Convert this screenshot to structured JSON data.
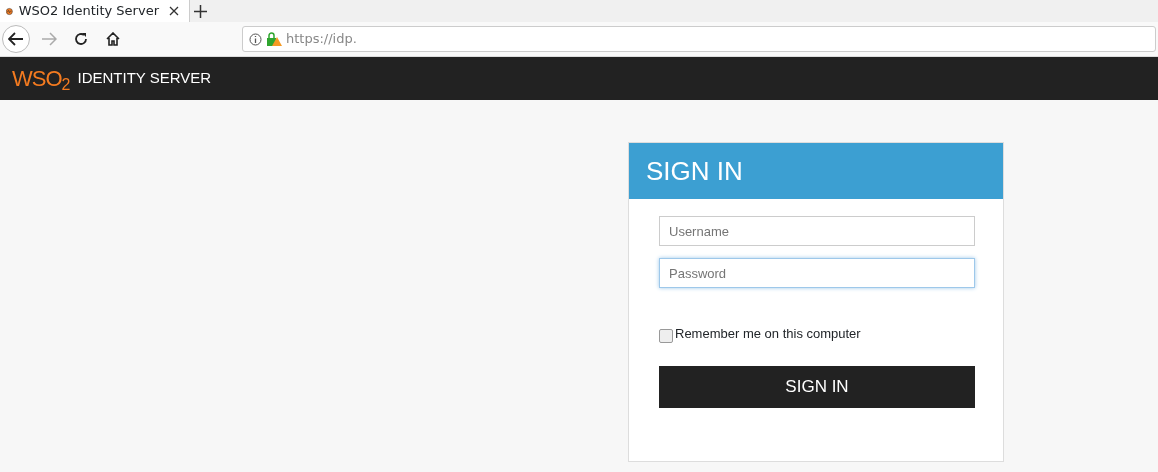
{
  "browser": {
    "tab_title": "WSO2 Identity Server",
    "url": "https://idp."
  },
  "header": {
    "logo": "WSO$_{2}$",
    "product": "IDENTITY SERVER"
  },
  "login": {
    "title": "SIGN IN",
    "fields": [
      {
        "placeholder": "Username",
        "focused": false
      },
      {
        "placeholder": "Password",
        "focused": true
      }
    ],
    "remember": {
      "label": "Remember me on this computer",
      "checked": false
    },
    "button": "SIGN IN"
  }
}
